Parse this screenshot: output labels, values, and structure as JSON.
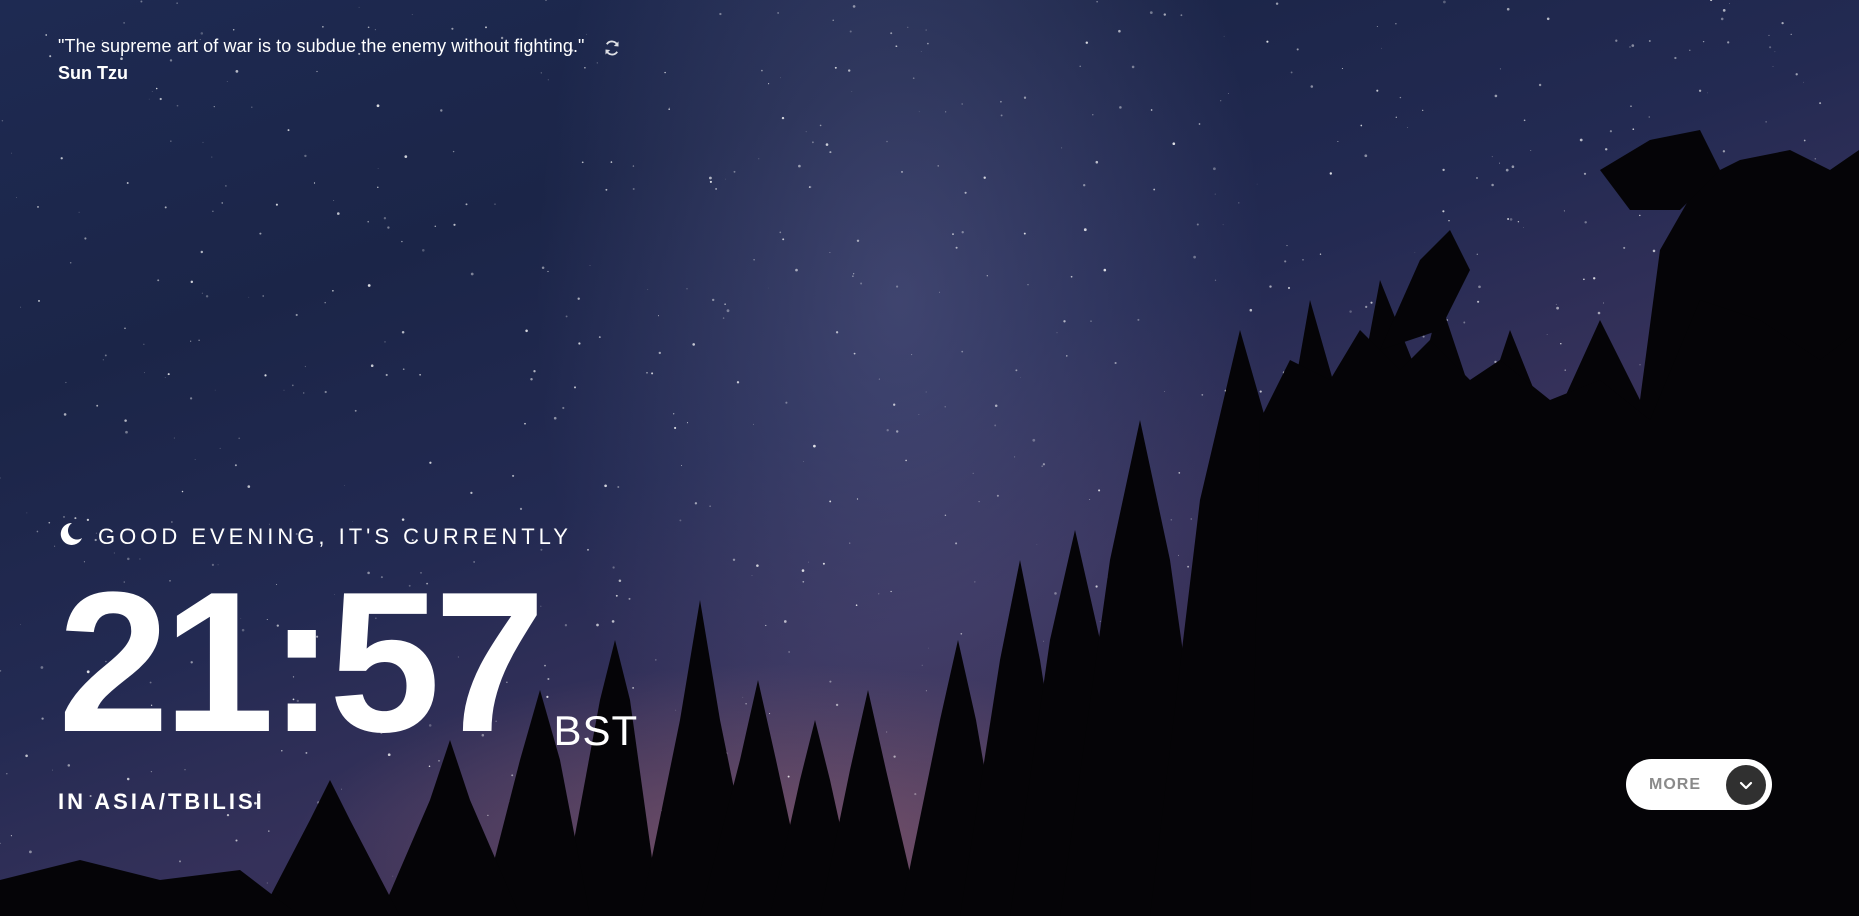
{
  "quote": {
    "text": "\"The supreme art of war is to subdue the enemy without fighting.\"",
    "author": "Sun Tzu",
    "refresh_icon": "refresh-icon"
  },
  "greeting": {
    "icon": "moon-icon",
    "text": "GOOD EVENING, IT'S CURRENTLY"
  },
  "clock": {
    "time": "21:57",
    "timezone": "BST"
  },
  "location": {
    "text": "IN ASIA/TBILISI"
  },
  "more_button": {
    "label": "MORE",
    "icon": "chevron-down-icon"
  },
  "colors": {
    "text": "#ffffff",
    "button_bg": "#ffffff",
    "button_label": "#8a8a8a",
    "chevron_bg": "#303030"
  }
}
